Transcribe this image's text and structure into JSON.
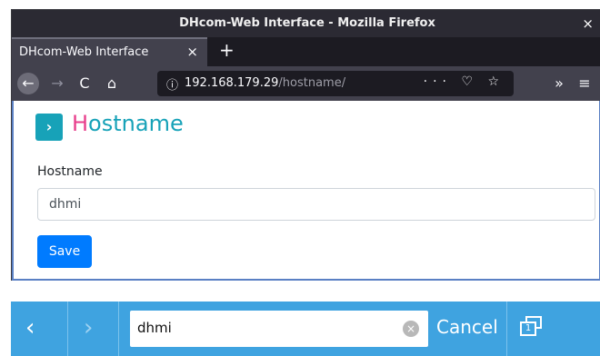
{
  "window": {
    "title": "DHcom-Web Interface - Mozilla Firefox",
    "close_glyph": "×"
  },
  "tabs": [
    {
      "label": "DHcom-Web Interface",
      "close_glyph": "×",
      "active": true
    }
  ],
  "newtab_glyph": "+",
  "toolbar": {
    "back_glyph": "←",
    "forward_glyph": "→",
    "reload_glyph": "C",
    "home_glyph": "⌂",
    "overflow_glyph": "»",
    "menu_glyph": "≡"
  },
  "urlbar": {
    "info_glyph": "ⓘ",
    "host": "192.168.179.29",
    "path": "/hostname/",
    "actions": "··· ♡ ☆"
  },
  "page": {
    "heading_button_glyph": "›",
    "heading_first": "H",
    "heading_rest": "ostname",
    "field_label": "Hostname",
    "field_value": "dhmi",
    "save_label": "Save"
  },
  "ime": {
    "prev_glyph": "‹",
    "next_glyph": "›",
    "value": "dhmi",
    "clear_glyph": "×",
    "cancel_label": "Cancel",
    "keyboard_glyph": "1"
  },
  "colors": {
    "accent": "#17a2b8",
    "heading_first_letter": "#e83e8c",
    "save_button": "#007bff",
    "ime_bar": "#3fa3e0"
  },
  "icons": [
    "close-icon",
    "plus-icon",
    "back-arrow-icon",
    "forward-arrow-icon",
    "reload-icon",
    "home-icon",
    "info-icon",
    "more-icon",
    "pocket-icon",
    "star-icon",
    "overflow-icon",
    "hamburger-menu-icon",
    "chevron-right-icon",
    "clear-icon",
    "keyboard-icon"
  ]
}
